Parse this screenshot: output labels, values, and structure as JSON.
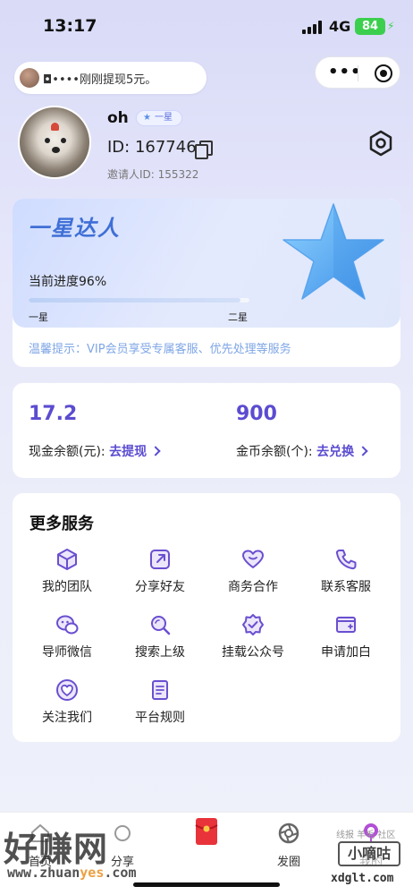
{
  "status_bar": {
    "time": "13:17",
    "network": "4G",
    "battery": "84"
  },
  "ticker": {
    "text": "◘••••刚刚提现5元。"
  },
  "profile": {
    "nickname": "oh",
    "level_badge": "一星",
    "user_id": "ID: 167746",
    "inviter": "邀请人ID: 155322"
  },
  "level_card": {
    "title": "一星达人",
    "progress_label": "当前进度96%",
    "progress_percent": 96,
    "start_level": "一星",
    "next_level": "二星",
    "tip": "温馨提示：VIP会员享受专属客服、优先处理等服务"
  },
  "balance": {
    "cash_value": "17.2",
    "cash_label": "现金余额(元):",
    "cash_action": "去提现",
    "coin_value": "900",
    "coin_label": "金币余额(个):",
    "coin_action": "去兑换"
  },
  "services": {
    "title": "更多服务",
    "items": [
      {
        "label": "我的团队",
        "icon": "cube-icon"
      },
      {
        "label": "分享好友",
        "icon": "share-icon"
      },
      {
        "label": "商务合作",
        "icon": "heart-icon"
      },
      {
        "label": "联系客服",
        "icon": "phone-icon"
      },
      {
        "label": "导师微信",
        "icon": "wechat-icon"
      },
      {
        "label": "搜索上级",
        "icon": "search-icon"
      },
      {
        "label": "挂载公众号",
        "icon": "verified-badge-icon"
      },
      {
        "label": "申请加白",
        "icon": "apply-card-icon"
      },
      {
        "label": "关注我们",
        "icon": "heart-circle-icon"
      },
      {
        "label": "平台规则",
        "icon": "document-icon"
      }
    ]
  },
  "tabbar": {
    "items": [
      {
        "label": "首页",
        "icon": "home-icon"
      },
      {
        "label": "分享",
        "icon": "share-icon"
      },
      {
        "label": "",
        "icon": "red-envelope-icon"
      },
      {
        "label": "发圈",
        "icon": "aperture-icon"
      },
      {
        "label": "我的",
        "icon": "user-icon"
      }
    ]
  },
  "watermarks": {
    "left_title": "好赚网",
    "left_url_a": "www.zhuan",
    "left_url_b": "yes",
    "left_url_c": ".com",
    "right_title": "小嘀咕",
    "right_url": "xdglt.com",
    "right_small": "线报 羊毛 社区"
  },
  "colors": {
    "accent": "#5b4cd0",
    "icon": "#7a5cd6",
    "tip": "#7fa6e6",
    "battery": "#3ccf4e"
  }
}
